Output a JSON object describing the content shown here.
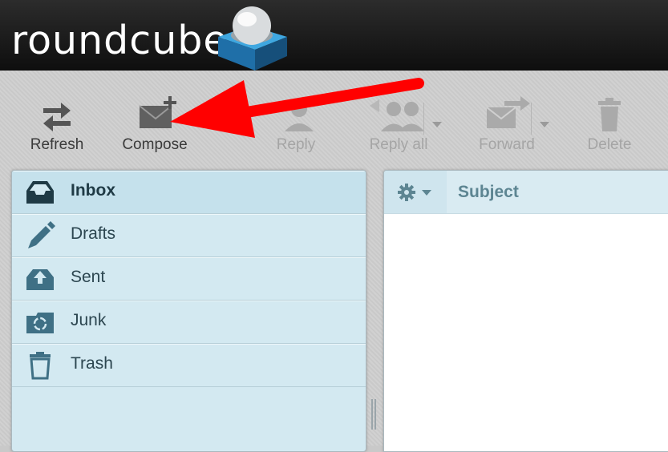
{
  "header": {
    "logo_text": "roundcube"
  },
  "toolbar": {
    "refresh_label": "Refresh",
    "compose_label": "Compose",
    "reply_label": "Reply",
    "reply_all_label": "Reply all",
    "forward_label": "Forward",
    "delete_label": "Delete"
  },
  "folders": {
    "items": [
      {
        "label": "Inbox",
        "icon": "inbox-icon",
        "selected": true
      },
      {
        "label": "Drafts",
        "icon": "pencil-icon",
        "selected": false
      },
      {
        "label": "Sent",
        "icon": "sent-icon",
        "selected": false
      },
      {
        "label": "Junk",
        "icon": "junk-icon",
        "selected": false
      },
      {
        "label": "Trash",
        "icon": "trash-icon",
        "selected": false
      }
    ]
  },
  "message_list": {
    "subject_header": "Subject"
  },
  "colors": {
    "header_bg": "#111111",
    "folder_bg": "#d3e9f1",
    "accent_blue": "#2a86c3",
    "annotation_arrow": "#ff0000"
  }
}
